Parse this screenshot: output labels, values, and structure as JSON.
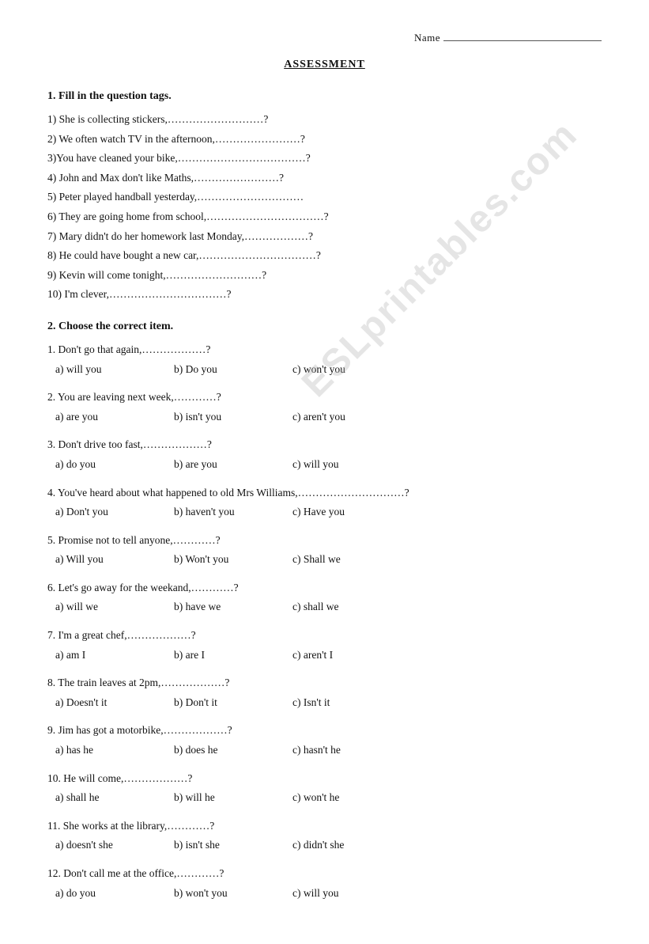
{
  "header": {
    "name_label": "Name",
    "title": "ASSESSMENT"
  },
  "section1": {
    "title": "1.   Fill in the question tags.",
    "items": [
      "1) She is collecting stickers,………………………?",
      "2) We often watch TV in the afternoon,……………………?",
      "3)You have cleaned your bike,………………………………?",
      "4) John and Max don't like Maths,……………………?",
      "5) Peter played handball yesterday,…………………………",
      "6) They are going home from school,……………………………?",
      "7) Mary didn't do her homework last Monday,………………?",
      "8) He could have bought a new car,……………………………?",
      "9) Kevin will come tonight,………………………?",
      "10) I'm clever,……………………………?"
    ]
  },
  "section2": {
    "title": "2.   Choose the correct item.",
    "questions": [
      {
        "num": "1.",
        "text": "Don't go that again,………………?",
        "options": [
          "a) will you",
          "b) Do you",
          "c) won't you"
        ]
      },
      {
        "num": "2.",
        "text": "You are leaving next week,…………?",
        "options": [
          "a) are you",
          "b) isn't you",
          "c) aren't you"
        ]
      },
      {
        "num": "3.",
        "text": "Don't drive too fast,………………?",
        "options": [
          "a) do you",
          "b) are you",
          "c) will you"
        ]
      },
      {
        "num": "4.",
        "text": "You've heard about what happened to old Mrs Williams,…………………………?",
        "options": [
          "a) Don't you",
          "b) haven't you",
          "c) Have you"
        ]
      },
      {
        "num": "5.",
        "text": "Promise not to tell anyone,…………?",
        "options": [
          "a) Will you",
          "b) Won't you",
          "c) Shall we"
        ]
      },
      {
        "num": "6.",
        "text": "Let's go away for the weekand,…………?",
        "options": [
          "a) will we",
          "b) have we",
          "c) shall we"
        ]
      },
      {
        "num": "7.",
        "text": "I'm a great chef,………………?",
        "options": [
          "a) am I",
          "b) are I",
          "c) aren't I"
        ]
      },
      {
        "num": "8.",
        "text": "The train leaves at 2pm,………………?",
        "options": [
          "a) Doesn't it",
          "b) Don't it",
          "c) Isn't it"
        ]
      },
      {
        "num": "9.",
        "text": "Jim has got a motorbike,………………?",
        "options": [
          "a) has he",
          "b) does he",
          "c) hasn't he"
        ]
      },
      {
        "num": "10.",
        "text": "He will come,………………?",
        "options": [
          "a) shall he",
          "b) will he",
          "c) won't he"
        ]
      },
      {
        "num": "11.",
        "text": "She works at the library,…………?",
        "options": [
          "a) doesn't she",
          "b) isn't she",
          "c) didn't she"
        ]
      },
      {
        "num": "12.",
        "text": "Don't call me at the office,…………?",
        "options": [
          "a) do you",
          "b) won't you",
          "c) will you"
        ]
      }
    ]
  },
  "watermark": "ESLprintables.com"
}
